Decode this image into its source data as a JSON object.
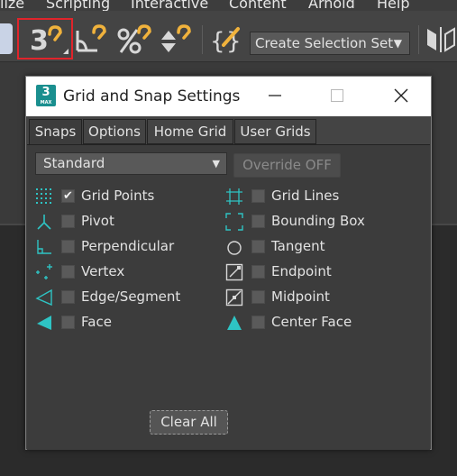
{
  "menu": {
    "items": [
      "lize",
      "Scripting",
      "Interactive",
      "Content",
      "Arnold",
      "Help"
    ]
  },
  "toolbar": {
    "selection_set_placeholder": "Create Selection Set",
    "active_tool": "snaps-toggle-3d"
  },
  "dialog": {
    "logo_text": "3",
    "logo_sub": "MAX",
    "title": "Grid and Snap Settings",
    "tabs": [
      {
        "label": "Snaps",
        "active": true
      },
      {
        "label": "Options",
        "active": false
      },
      {
        "label": "Home Grid",
        "active": false
      },
      {
        "label": "User Grids",
        "active": false
      }
    ],
    "dropdown_value": "Standard",
    "override_label": "Override OFF",
    "snaps_left": [
      {
        "label": "Grid Points",
        "checked": true,
        "icon": "grid-points-icon"
      },
      {
        "label": "Pivot",
        "checked": false,
        "icon": "pivot-icon"
      },
      {
        "label": "Perpendicular",
        "checked": false,
        "icon": "perpendicular-icon"
      },
      {
        "label": "Vertex",
        "checked": false,
        "icon": "vertex-icon"
      },
      {
        "label": "Edge/Segment",
        "checked": false,
        "icon": "edge-segment-icon"
      },
      {
        "label": "Face",
        "checked": false,
        "icon": "face-icon"
      }
    ],
    "snaps_right": [
      {
        "label": "Grid Lines",
        "checked": false,
        "icon": "grid-lines-icon"
      },
      {
        "label": "Bounding Box",
        "checked": false,
        "icon": "bounding-box-icon"
      },
      {
        "label": "Tangent",
        "checked": false,
        "icon": "tangent-icon"
      },
      {
        "label": "Endpoint",
        "checked": false,
        "icon": "endpoint-icon"
      },
      {
        "label": "Midpoint",
        "checked": false,
        "icon": "midpoint-icon"
      },
      {
        "label": "Center Face",
        "checked": false,
        "icon": "center-face-icon"
      }
    ],
    "clear_all_label": "Clear All",
    "check_mark": "✔"
  },
  "colors": {
    "accent_teal": "#2ec4c4",
    "active_tool_border": "#e0242b",
    "snap_icon_gold": "#f0b23c"
  }
}
